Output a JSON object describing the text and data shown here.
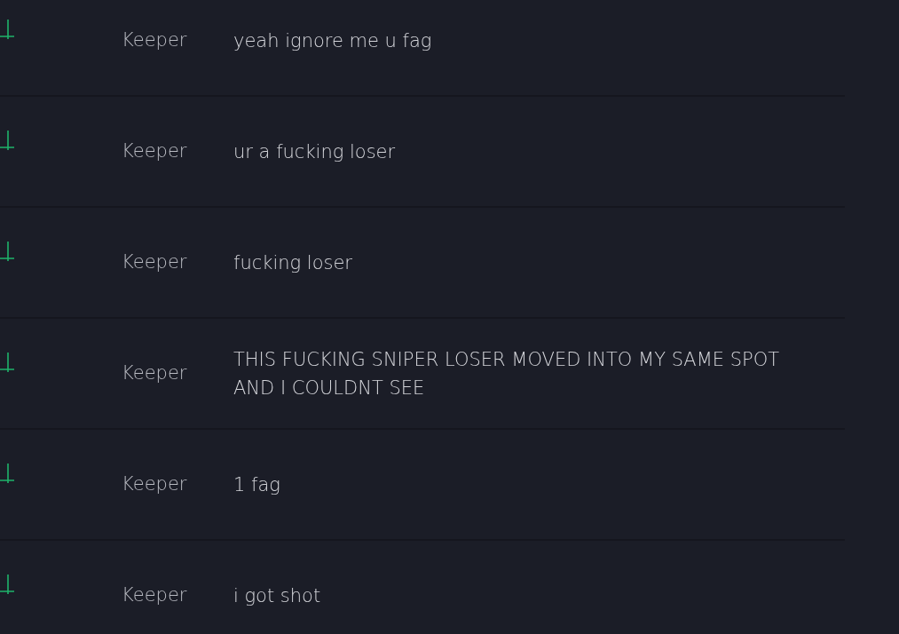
{
  "messages": [
    {
      "author": "Keeper",
      "text": "yeah ignore me u fag"
    },
    {
      "author": "Keeper",
      "text": "ur a fucking loser"
    },
    {
      "author": "Keeper",
      "text": "fucking loser"
    },
    {
      "author": "Keeper",
      "text": "THIS FUCKING SNIPER LOSER MOVED INTO MY SAME SPOT AND I COULDNT SEE"
    },
    {
      "author": "Keeper",
      "text": "1 fag"
    },
    {
      "author": "Keeper",
      "text": "i got shot"
    }
  ]
}
